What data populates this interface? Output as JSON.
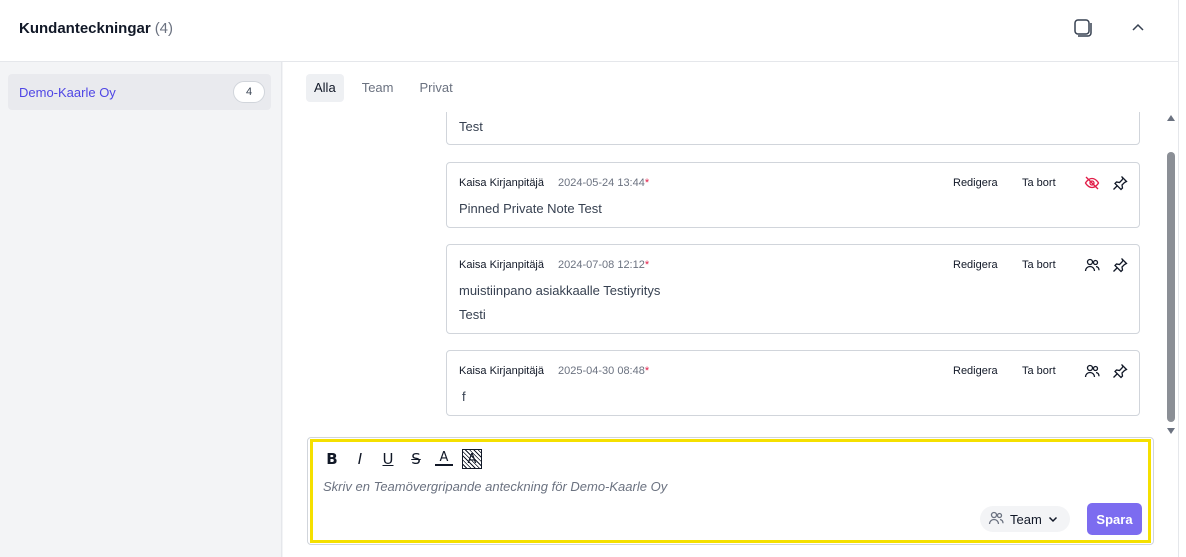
{
  "header": {
    "title": "Kundanteckningar",
    "count": "(4)",
    "icons": [
      "windows-icon",
      "chevron-up-icon"
    ]
  },
  "sidebar": {
    "items": [
      {
        "label": "Demo-Kaarle Oy",
        "count": "4"
      }
    ]
  },
  "tabs": [
    {
      "label": "Alla",
      "active": true
    },
    {
      "label": "Team",
      "active": false
    },
    {
      "label": "Privat",
      "active": false
    }
  ],
  "notes": [
    {
      "lines": [
        "Test"
      ]
    },
    {
      "author": "Kaisa Kirjanpitäjä",
      "date": "2024-05-24 13:44",
      "edit_label": "Redigera",
      "delete_label": "Ta bort",
      "visibility_icon": "eye-off-icon",
      "lines": [
        "Pinned Private Note Test"
      ]
    },
    {
      "author": "Kaisa Kirjanpitäjä",
      "date": "2024-07-08 12:12",
      "edit_label": "Redigera",
      "delete_label": "Ta bort",
      "visibility_icon": "team-icon",
      "lines": [
        "muistiinpano asiakkaalle Testiyritys",
        "Testi"
      ]
    },
    {
      "author": "Kaisa Kirjanpitäjä",
      "date": "2025-04-30 08:48",
      "edit_label": "Redigera",
      "delete_label": "Ta bort",
      "visibility_icon": "team-icon",
      "lines": [
        "f"
      ]
    }
  ],
  "editor": {
    "toolbar": [
      "B",
      "I",
      "U",
      "S",
      "A",
      "A"
    ],
    "placeholder": "Skriv en Teamövergripande anteckning för Demo-Kaarle Oy",
    "visibility_value": "Team",
    "save_label": "Spara"
  },
  "colors": {
    "accent": "#7c6cf0",
    "link": "#4f46e5",
    "highlight": "#f5e000",
    "private_icon": "#e11d48"
  }
}
